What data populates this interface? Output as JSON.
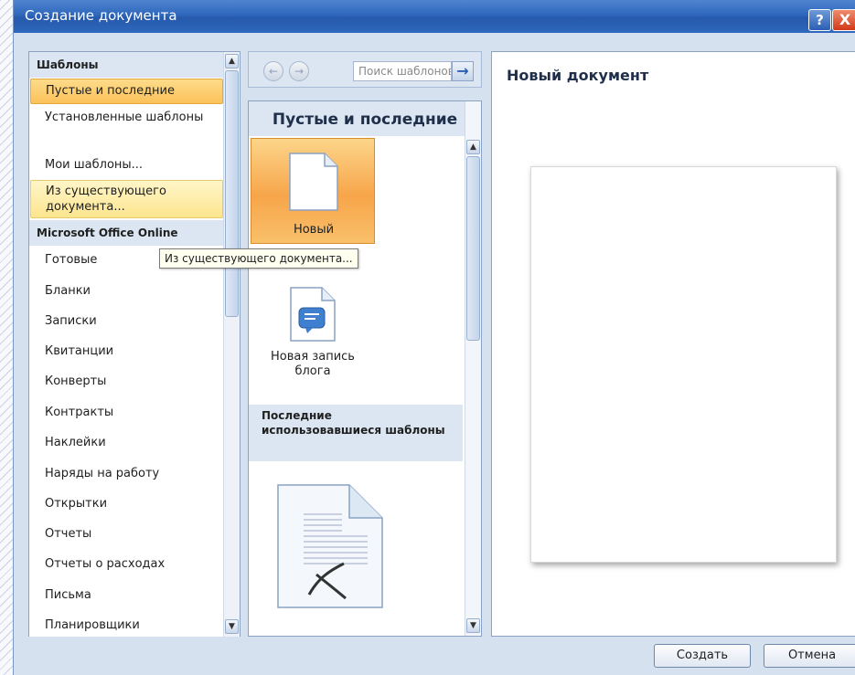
{
  "window": {
    "title": "Создание документа",
    "help_label": "?",
    "close_label": "X"
  },
  "left": {
    "header_templates": "Шаблоны",
    "items_templates": [
      "Пустые и последние",
      "Установленные шаблоны",
      "Мои шаблоны...",
      "Из существующего документа..."
    ],
    "header_online": "Microsoft Office Online",
    "items_online": [
      "Готовые",
      "Бланки",
      "Записки",
      "Квитанции",
      "Конверты",
      "Контракты",
      "Наклейки",
      "Наряды на работу",
      "Открытки",
      "Отчеты",
      "Отчеты о расходах",
      "Письма",
      "Планировщики"
    ]
  },
  "middle": {
    "search_placeholder": "Поиск шаблонов",
    "back_icon": "back-arrow-icon",
    "forward_icon": "forward-arrow-icon",
    "search_go_icon": "arrow-right-icon",
    "title": "Пустые и последние",
    "tiles": [
      {
        "label": "Новый",
        "icon": "blank-document-icon"
      },
      {
        "label": "Новая запись блога",
        "icon": "blog-post-icon"
      }
    ],
    "recent_header": "Последние использовавшиеся шаблоны",
    "recent_icon": "template-document-icon"
  },
  "right": {
    "preview_title": "Новый документ"
  },
  "buttons": {
    "create": "Создать",
    "cancel": "Отмена"
  },
  "tooltip": "Из существующего документа...",
  "colors": {
    "titlebar": "#2f68bd",
    "selected": "#fbc25a",
    "hover": "#fde58e",
    "panel_header": "#dce6f2"
  }
}
